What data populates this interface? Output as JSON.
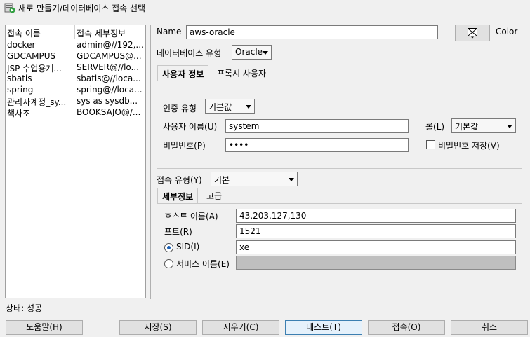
{
  "window": {
    "title": "새로 만들기/데이터베이스 접속 선택",
    "icon": "db-add-icon"
  },
  "connections": {
    "headers": [
      "접속 이름",
      "접속 세부정보"
    ],
    "rows": [
      [
        "docker",
        "admin@//192,..."
      ],
      [
        "GDCAMPUS",
        "GDCAMPUS@..."
      ],
      [
        "JSP 수업용계...",
        "SERVER@//lo..."
      ],
      [
        "sbatis",
        "sbatis@//loca..."
      ],
      [
        "spring",
        "spring@//loca..."
      ],
      [
        "관리자계정_sy...",
        "sys as sysdb..."
      ],
      [
        "책사조",
        "BOOKSAJO@/..."
      ]
    ]
  },
  "form": {
    "name_label": "Name",
    "name_value": "aws-oracle",
    "color_label": "Color",
    "db_type_label": "데이터베이스 유형",
    "db_type_value": "Oracle",
    "user_tabs": [
      "사용자 정보",
      "프록시 사용자"
    ],
    "auth_type_label": "인증 유형",
    "auth_type_value": "기본값",
    "username_label": "사용자 이름(U)",
    "username_value": "system",
    "role_label": "롤(L)",
    "role_value": "기본값",
    "password_label": "비밀번호(P)",
    "password_value": "••••",
    "save_password_label": "비밀번호 저장(V)",
    "conn_type_label": "접속 유형(Y)",
    "conn_type_value": "기본",
    "detail_tabs": [
      "세부정보",
      "고급"
    ],
    "host_label": "호스트 이름(A)",
    "host_value": "43,203,127,130",
    "port_label": "포트(R)",
    "port_value": "1521",
    "sid_label": "SID(I)",
    "sid_value": "xe",
    "service_label": "서비스 이름(E)"
  },
  "status": "상태: 성공",
  "buttons": {
    "help": "도움말(H)",
    "save": "저장(S)",
    "clear": "지우기(C)",
    "test": "테스트(T)",
    "connect": "접속(O)",
    "cancel": "취소"
  }
}
